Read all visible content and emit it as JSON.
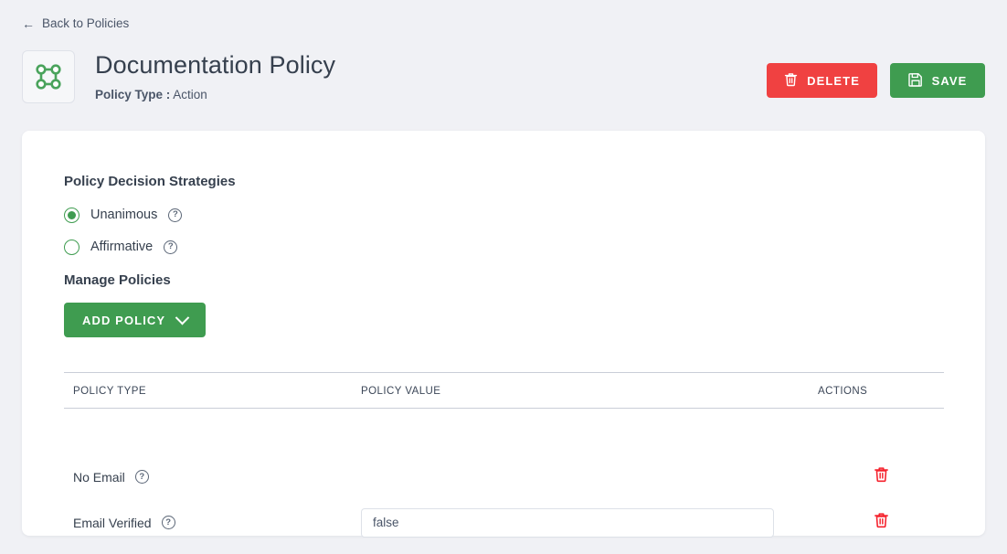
{
  "nav": {
    "back_label": "Back to Policies",
    "back_icon": "arrow-left-icon"
  },
  "header": {
    "icon": "policy-graph-icon",
    "title": "Documentation Policy",
    "subtitle_label": "Policy Type :",
    "subtitle_value": "Action",
    "actions": {
      "delete_label": "DELETE",
      "delete_icon": "trash-icon",
      "save_label": "SAVE",
      "save_icon": "floppy-disk-icon"
    }
  },
  "main": {
    "strategies_title": "Policy Decision Strategies",
    "strategies": [
      {
        "label": "Unanimous",
        "selected": true,
        "help_icon": "help-circle-icon"
      },
      {
        "label": "Affirmative",
        "selected": false,
        "help_icon": "help-circle-icon"
      }
    ],
    "manage_title": "Manage Policies",
    "add_policy_label": "ADD POLICY",
    "add_policy_icon": "chevron-down-icon",
    "table": {
      "columns": [
        "POLICY TYPE",
        "POLICY VALUE",
        "ACTIONS"
      ],
      "rows": [
        {
          "type": "No Email",
          "help_icon": "help-circle-icon",
          "value": null,
          "has_value_input": false,
          "action_icon": "trash-icon"
        },
        {
          "type": "Email Verified",
          "help_icon": "help-circle-icon",
          "value": "false",
          "has_value_input": true,
          "action_icon": "trash-icon"
        }
      ]
    }
  },
  "colors": {
    "page_background": "#f0f1f5",
    "card_background": "#ffffff",
    "accent_green": "#3f9c50",
    "danger_red": "#f04141",
    "text_primary": "#36404e",
    "text_secondary": "#4a5568",
    "border": "#c9ced8"
  }
}
